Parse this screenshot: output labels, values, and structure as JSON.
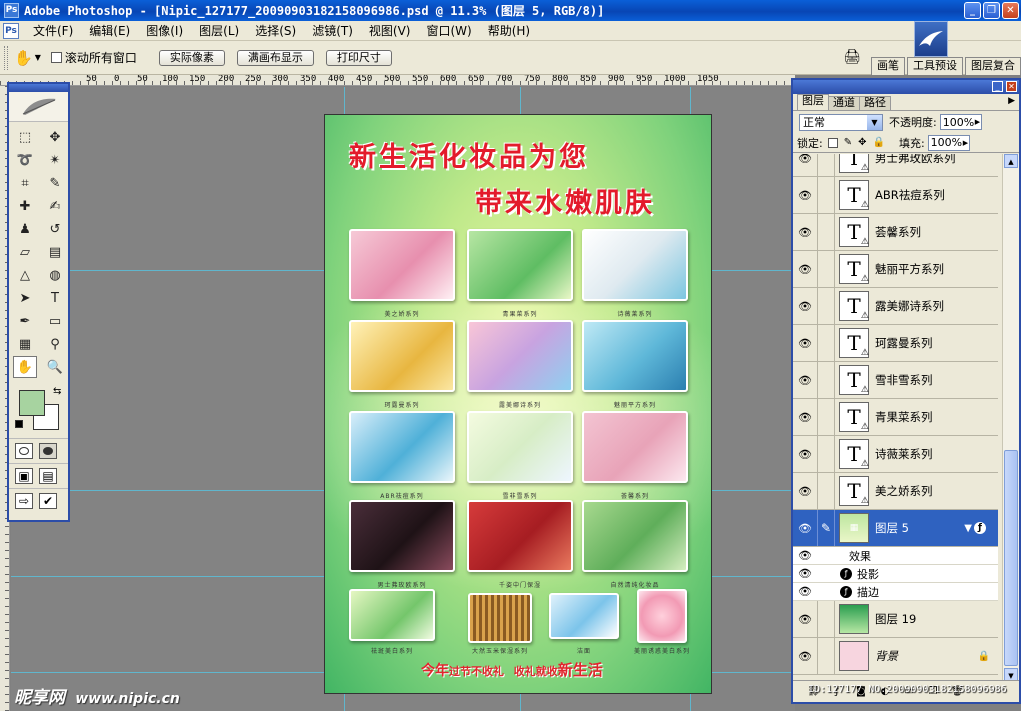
{
  "window": {
    "title": "Adobe Photoshop - [Nipic_127177_20090903182158096986.psd @ 11.3% (图层 5, RGB/8)]",
    "buttons": [
      "_",
      "❐",
      "✕"
    ]
  },
  "menu": {
    "items": [
      "文件(F)",
      "编辑(E)",
      "图像(I)",
      "图层(L)",
      "选择(S)",
      "滤镜(T)",
      "视图(V)",
      "窗口(W)",
      "帮助(H)"
    ]
  },
  "options": {
    "tool_icon": "hand-icon",
    "scroll_all_label": "滚动所有窗口",
    "buttons": [
      "实际像素",
      "满画布显示",
      "打印尺寸"
    ],
    "palette_tabs": [
      "画笔",
      "工具预设",
      "图层复合"
    ]
  },
  "ruler": {
    "top_labels": [
      "50",
      "0",
      "50",
      "100",
      "150",
      "200",
      "250",
      "300",
      "350",
      "400",
      "450",
      "500",
      "550",
      "600",
      "650",
      "700",
      "750",
      "800",
      "850",
      "900",
      "950",
      "1000",
      "1050"
    ]
  },
  "poster": {
    "headline1": "新生活化妆品为您",
    "headline2": "带来水嫩肌肤",
    "captions": [
      "美之娇系列",
      "青果菜系列",
      "诗薇莱系列",
      "珂露曼系列",
      "露美娜诗系列",
      "魅丽平方系列",
      "ABR祛痘系列",
      "雪非雪系列",
      "荟馨系列",
      "男士弗玫欧系列",
      "千姿中门保湿",
      "自然清纯化妆品",
      "祛斑美白系列",
      "大然玉米保湿系列",
      "洁面",
      "美丽诱惑美白系列"
    ],
    "slogan": {
      "part1": "今年",
      "part2": "过节不收礼",
      "part3": "收礼就收",
      "part4": "新生活"
    }
  },
  "watermark": {
    "site": "昵享网",
    "url": "www.nipic.cn"
  },
  "colors": {
    "foreground": "#a7d3a0",
    "background": "#ffffff",
    "selection": "#2f62c0"
  },
  "layers_panel": {
    "tabs": [
      "图层",
      "通道",
      "路径"
    ],
    "blend_mode": "正常",
    "opacity_label": "不透明度:",
    "opacity": "100%",
    "lock_label": "锁定:",
    "fill_label": "填充:",
    "fill": "100%",
    "layers": [
      {
        "name": "男士弗玫欧系列",
        "type": "text"
      },
      {
        "name": "ABR祛痘系列",
        "type": "text"
      },
      {
        "name": "荟馨系列",
        "type": "text"
      },
      {
        "name": "魅丽平方系列",
        "type": "text"
      },
      {
        "name": "露美娜诗系列",
        "type": "text"
      },
      {
        "name": "珂露曼系列",
        "type": "text"
      },
      {
        "name": "雪非雪系列",
        "type": "text"
      },
      {
        "name": "青果菜系列",
        "type": "text"
      },
      {
        "name": "诗薇莱系列",
        "type": "text"
      },
      {
        "name": "美之娇系列",
        "type": "text"
      }
    ],
    "selected_layer": "图层 5",
    "effects_label": "效果",
    "effects": [
      "投影",
      "描边"
    ],
    "layer19": "图层 19",
    "background_layer": "背景"
  },
  "status": {
    "overlay": "ID:127177 NO:20090903182158096986"
  }
}
